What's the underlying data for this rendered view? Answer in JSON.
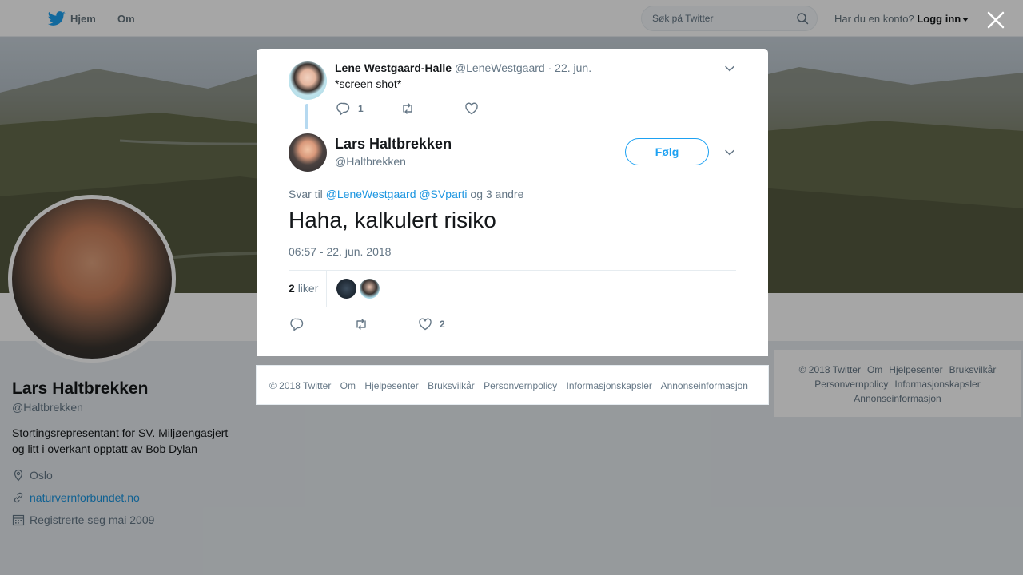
{
  "topbar": {
    "home_label": "Hjem",
    "about_label": "Om",
    "search_placeholder": "Søk på Twitter",
    "account_prompt": "Har du en konto?",
    "login_label": "Logg inn"
  },
  "profile": {
    "name": "Lars Haltbrekken",
    "handle": "@Haltbrekken",
    "bio": "Stortingsrepresentant for SV. Miljøengasjert og litt i overkant opptatt av Bob Dylan",
    "location": "Oslo",
    "website": "naturvernforbundet.no",
    "joined": "Registrerte seg mai 2009"
  },
  "side_footer": {
    "items": [
      "© 2018 Twitter",
      "Om",
      "Hjelpesenter",
      "Bruksvilkår",
      "Personvernpolicy",
      "Informasjonskapsler",
      "Annonseinformasjon"
    ]
  },
  "modal": {
    "parent_tweet": {
      "name": "Lene Westgaard-Halle",
      "handle": "@LeneWestgaard",
      "date": "· 22. jun.",
      "text": "*screen shot*",
      "reply_count": "1"
    },
    "tweet": {
      "name": "Lars Haltbrekken",
      "handle": "@Haltbrekken",
      "follow_label": "Følg",
      "reply_prefix": "Svar til",
      "mention1": "@LeneWestgaard",
      "mention2": "@SVparti",
      "reply_suffix": "og 3 andre",
      "text": "Haha, kalkulert risiko",
      "timestamp": "06:57 - 22. jun. 2018",
      "likes_count": "2",
      "likes_label": "liker",
      "like_action_count": "2"
    },
    "footer": {
      "items": [
        "© 2018 Twitter",
        "Om",
        "Hjelpesenter",
        "Bruksvilkår",
        "Personvernpolicy",
        "Informasjonskapsler",
        "Annonseinformasjon"
      ]
    }
  },
  "colors": {
    "accent": "#1da1f2",
    "link": "#1b95e0",
    "muted": "#657786"
  }
}
